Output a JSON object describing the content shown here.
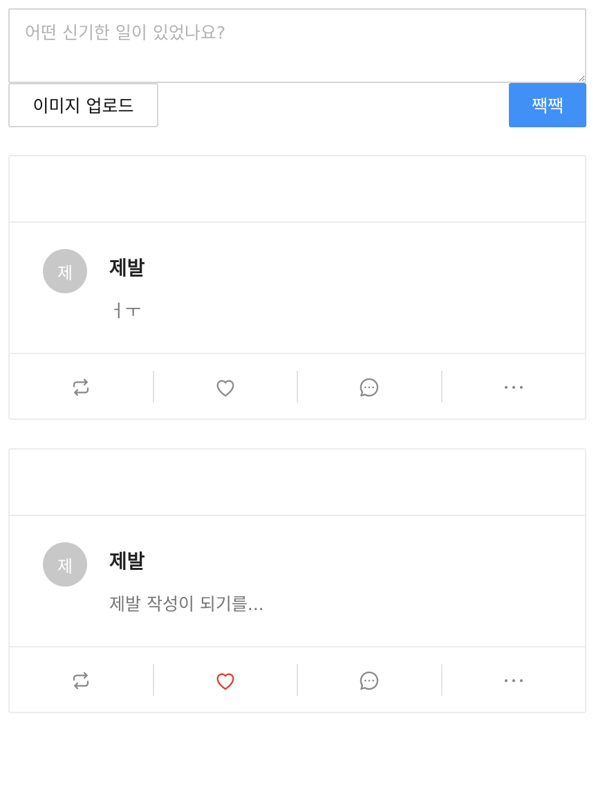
{
  "composer": {
    "placeholder": "어떤 신기한 일이 있었나요?",
    "upload_label": "이미지 업로드",
    "submit_label": "짹짹"
  },
  "colors": {
    "accent": "#4090f5",
    "liked": "#e0392b",
    "icon": "#888888",
    "avatar_bg": "#c8c8c8"
  },
  "posts": [
    {
      "avatar_initial": "제",
      "author": "제발",
      "text": "ㅓㅜ",
      "liked": false,
      "actions": [
        "retweet-icon",
        "heart-icon",
        "comment-icon",
        "more-icon"
      ]
    },
    {
      "avatar_initial": "제",
      "author": "제발",
      "text": "제발 작성이 되기를...",
      "liked": true,
      "actions": [
        "retweet-icon",
        "heart-icon",
        "comment-icon",
        "more-icon"
      ]
    }
  ]
}
